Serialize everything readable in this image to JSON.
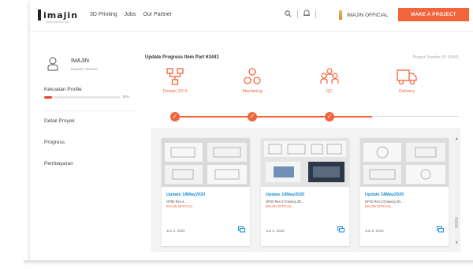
{
  "nav": {
    "brand": "imajin",
    "brand_sub": "manufacturing",
    "links": [
      "3D Printing",
      "Jobs",
      "Our Partner"
    ],
    "user_name": "IMAJIN OFFICIAL",
    "make_project": "MAKE A PROJECT"
  },
  "sidebar": {
    "user_name": "IMAJIN",
    "user_role": "Repairer Service",
    "profile_label": "Kekuatan Profile",
    "profile_progress": 0.1,
    "profile_percent": "10%",
    "menu": [
      "Detail Proyek",
      "Progress",
      "Pembayaran"
    ]
  },
  "main": {
    "title": "Update Progress Item Part 63441",
    "right_text": "Project Transfer ID: 63441",
    "steps": [
      {
        "label": "Desain 2D 3",
        "icon": "design-network-icon"
      },
      {
        "label": "Machining",
        "icon": "machining-icon"
      },
      {
        "label": "QC",
        "icon": "team-qc-icon"
      },
      {
        "label": "Delivery",
        "icon": "delivery-truck-icon"
      }
    ],
    "completed_steps": 3,
    "check_glyph": "✓",
    "cards": [
      {
        "title": "Update 18May2020",
        "desc": "DP90 Rev.4...",
        "author": "IMAJIN OFFICIAL",
        "date": "Jun 6, 2020"
      },
      {
        "title": "Update 18May2020",
        "desc": "DP40 Rev.3 Drawing 3D...",
        "author": "IMAJIN OFFICIAL",
        "date": "Jun 6, 2020"
      },
      {
        "title": "Update 18May2020",
        "desc": "DP40 Rev.3 Drawing 2D...",
        "author": "IMAJIN OFFICIAL",
        "date": "Jun 8, 2020"
      }
    ]
  },
  "colors": {
    "accent": "#f3643a",
    "link": "#1a8fd8"
  }
}
